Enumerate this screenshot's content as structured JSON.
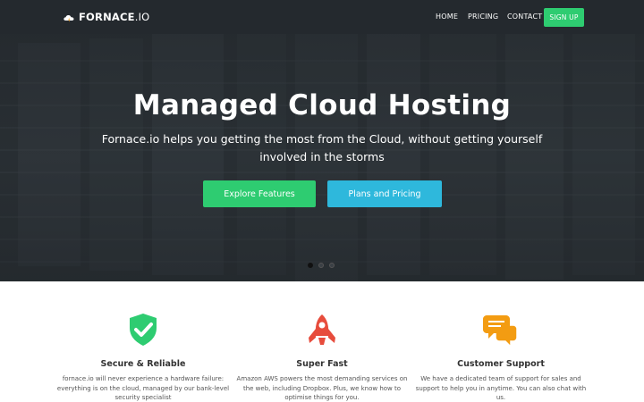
{
  "navbar": {
    "brand_bold": "FORNACE",
    "brand_light": ".IO",
    "links": [
      "HOME",
      "PRICING",
      "CONTACT"
    ],
    "signup_label": "SIGN UP"
  },
  "hero": {
    "title": "Managed Cloud Hosting",
    "subtitle": "Fornace.io helps you getting the most from the Cloud, without getting yourself involved in the storms",
    "explore_label": "Explore Features",
    "pricing_label": "Plans and Pricing",
    "carousel_active": 1,
    "carousel_count": 3
  },
  "features": [
    {
      "icon": "shield-check-icon",
      "title": "Secure & Reliable",
      "description": "fornace.io will never experience a hardware failure: everything is on the cloud, managed by our bank-level security specialist"
    },
    {
      "icon": "rocket-icon",
      "title": "Super Fast",
      "description": "Amazon AWS powers the most demanding services on the web, including Dropbox. Plus, we know how to optimise things for you."
    },
    {
      "icon": "chat-bubbles-icon",
      "title": "Customer Support",
      "description": "We have a dedicated team of support for sales and support to help you in anytime. You can also chat with us."
    }
  ],
  "colors": {
    "navbar_bg": "#24292e",
    "green": "#2ecc71",
    "blue": "#2eb8dc",
    "shield_green": "#2ecc71",
    "rocket_red": "#e74c3c",
    "chat_orange": "#f39c12"
  }
}
